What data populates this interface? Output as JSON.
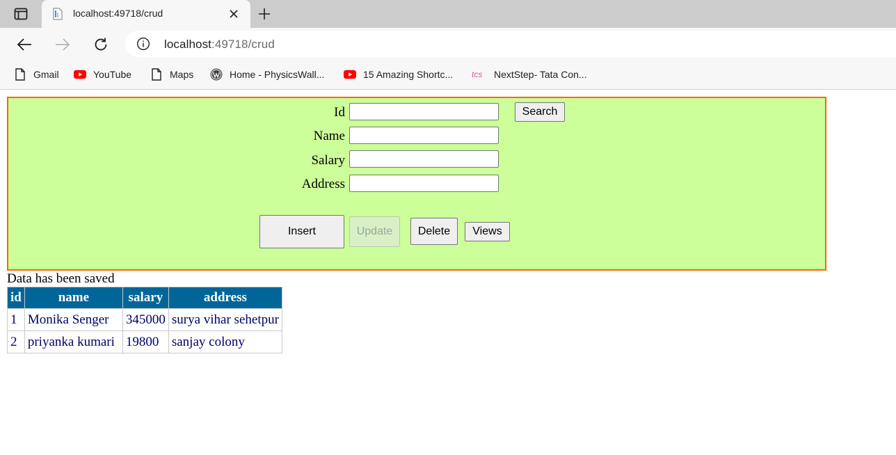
{
  "browser": {
    "tab": {
      "title": "localhost:49718/crud"
    },
    "address": {
      "host": "localhost",
      "rest": ":49718/crud"
    },
    "bookmarks": [
      {
        "label": "Gmail",
        "icon": "page-icon"
      },
      {
        "label": "YouTube",
        "icon": "youtube-icon"
      },
      {
        "label": "Maps",
        "icon": "page-icon"
      },
      {
        "label": "Home - PhysicsWall...",
        "icon": "wordpress-icon"
      },
      {
        "label": "15 Amazing Shortc...",
        "icon": "youtube-icon"
      },
      {
        "label": "NextStep- Tata Con...",
        "icon": "tcs-icon"
      }
    ]
  },
  "form": {
    "id_label": "Id",
    "name_label": "Name",
    "salary_label": "Salary",
    "address_label": "Address",
    "id_value": "",
    "name_value": "",
    "salary_value": "",
    "address_value": "",
    "search_label": "Search",
    "insert_label": "Insert",
    "update_label": "Update",
    "delete_label": "Delete",
    "views_label": "Views"
  },
  "status_message": "Data has been saved",
  "table": {
    "headers": [
      "id",
      "name",
      "salary",
      "address"
    ],
    "rows": [
      [
        "1",
        "Monika Senger",
        "345000",
        "surya vihar sehetpur"
      ],
      [
        "2",
        "priyanka kumari",
        "19800",
        "sanjay colony"
      ]
    ]
  },
  "colors": {
    "panel_bg": "#ccff99",
    "panel_border": "#ff6600",
    "header_bg": "#006699",
    "cell_text": "#000066",
    "youtube_red": "#ff0000"
  }
}
